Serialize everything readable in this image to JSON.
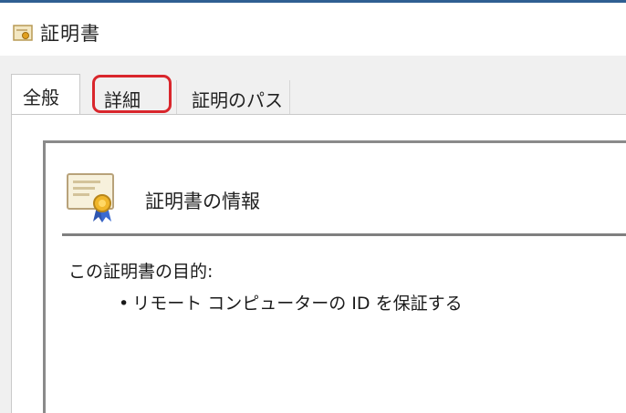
{
  "window": {
    "title": "証明書"
  },
  "tabs": [
    {
      "label": "全般",
      "selected": true
    },
    {
      "label": "詳細",
      "selected": false,
      "highlighted": true
    },
    {
      "label": "証明のパス",
      "selected": false
    }
  ],
  "general": {
    "heading": "証明書の情報",
    "purpose_label": "この証明書の目的:",
    "purposes": [
      "リモート コンピューターの ID を保証する"
    ]
  },
  "icons": {
    "title": "certificate-icon",
    "info": "certificate-ribbon-icon"
  },
  "colors": {
    "highlight": "#d9262c",
    "dialog_background": "#f0f0f0"
  }
}
